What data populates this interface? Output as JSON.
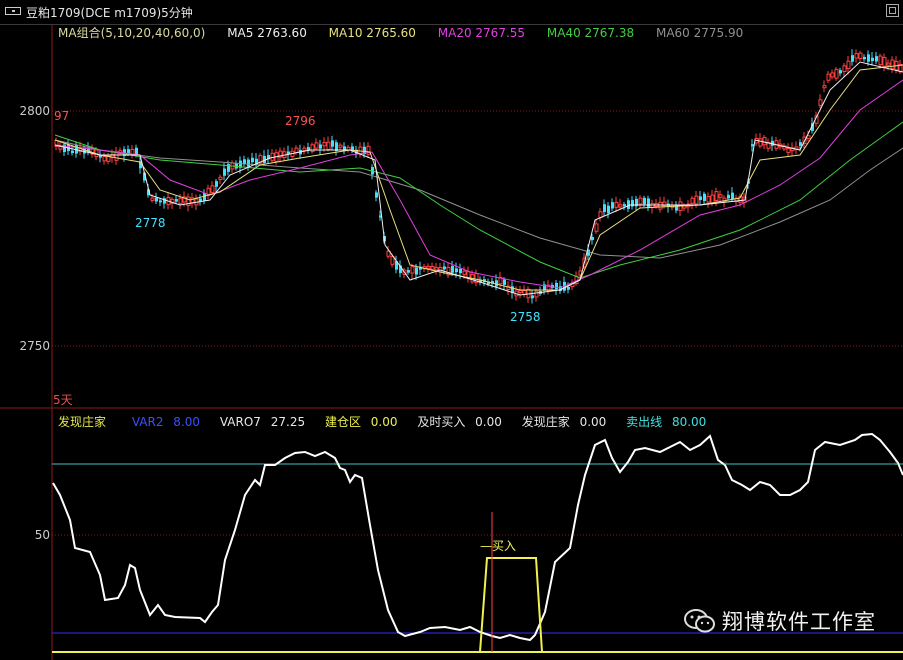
{
  "window": {
    "title": "豆粕1709(DCE m1709)5分钟"
  },
  "ma_bar": {
    "items": [
      {
        "label": "MA组合(5,10,20,40,60,0)",
        "color": "#d9d9a0"
      },
      {
        "label": "MA5 2763.60",
        "color": "#f0f0f0"
      },
      {
        "label": "MA10 2765.60",
        "color": "#e8e080"
      },
      {
        "label": "MA20 2767.55",
        "color": "#e040e0"
      },
      {
        "label": "MA40 2767.38",
        "color": "#40d040"
      },
      {
        "label": "MA60 2775.90",
        "color": "#909090"
      }
    ]
  },
  "price_axis": {
    "top": "2800",
    "bottom": "2750"
  },
  "price_points": {
    "p97": "97",
    "p2796": "2796",
    "p2778": "2778",
    "p2758": "2758"
  },
  "days_label": "5天",
  "indicator_bar": {
    "items": [
      {
        "name": "发现庄家",
        "value": "",
        "color": "#e6e650"
      },
      {
        "name": "VAR2",
        "value": "8.00",
        "color": "#3a50ff"
      },
      {
        "name": "VARO7",
        "value": "27.25",
        "color": "#e6e6e6"
      },
      {
        "name": "建仓区",
        "value": "0.00",
        "color": "#f0f050"
      },
      {
        "name": "及时买入",
        "value": "0.00",
        "color": "#e6e6e6"
      },
      {
        "name": "发现庄家",
        "value": "0.00",
        "color": "#e6e6e6"
      },
      {
        "name": "卖出线",
        "value": "80.00",
        "color": "#40e0e0"
      }
    ]
  },
  "indicator_axis": {
    "mid": "50"
  },
  "buy_label": "—买入",
  "watermark": {
    "text": "翔博软件工作室"
  },
  "colors": {
    "up": "#ff4040",
    "down": "#40e0ff",
    "bg": "#000000",
    "grid": "#8b1a1a"
  }
}
